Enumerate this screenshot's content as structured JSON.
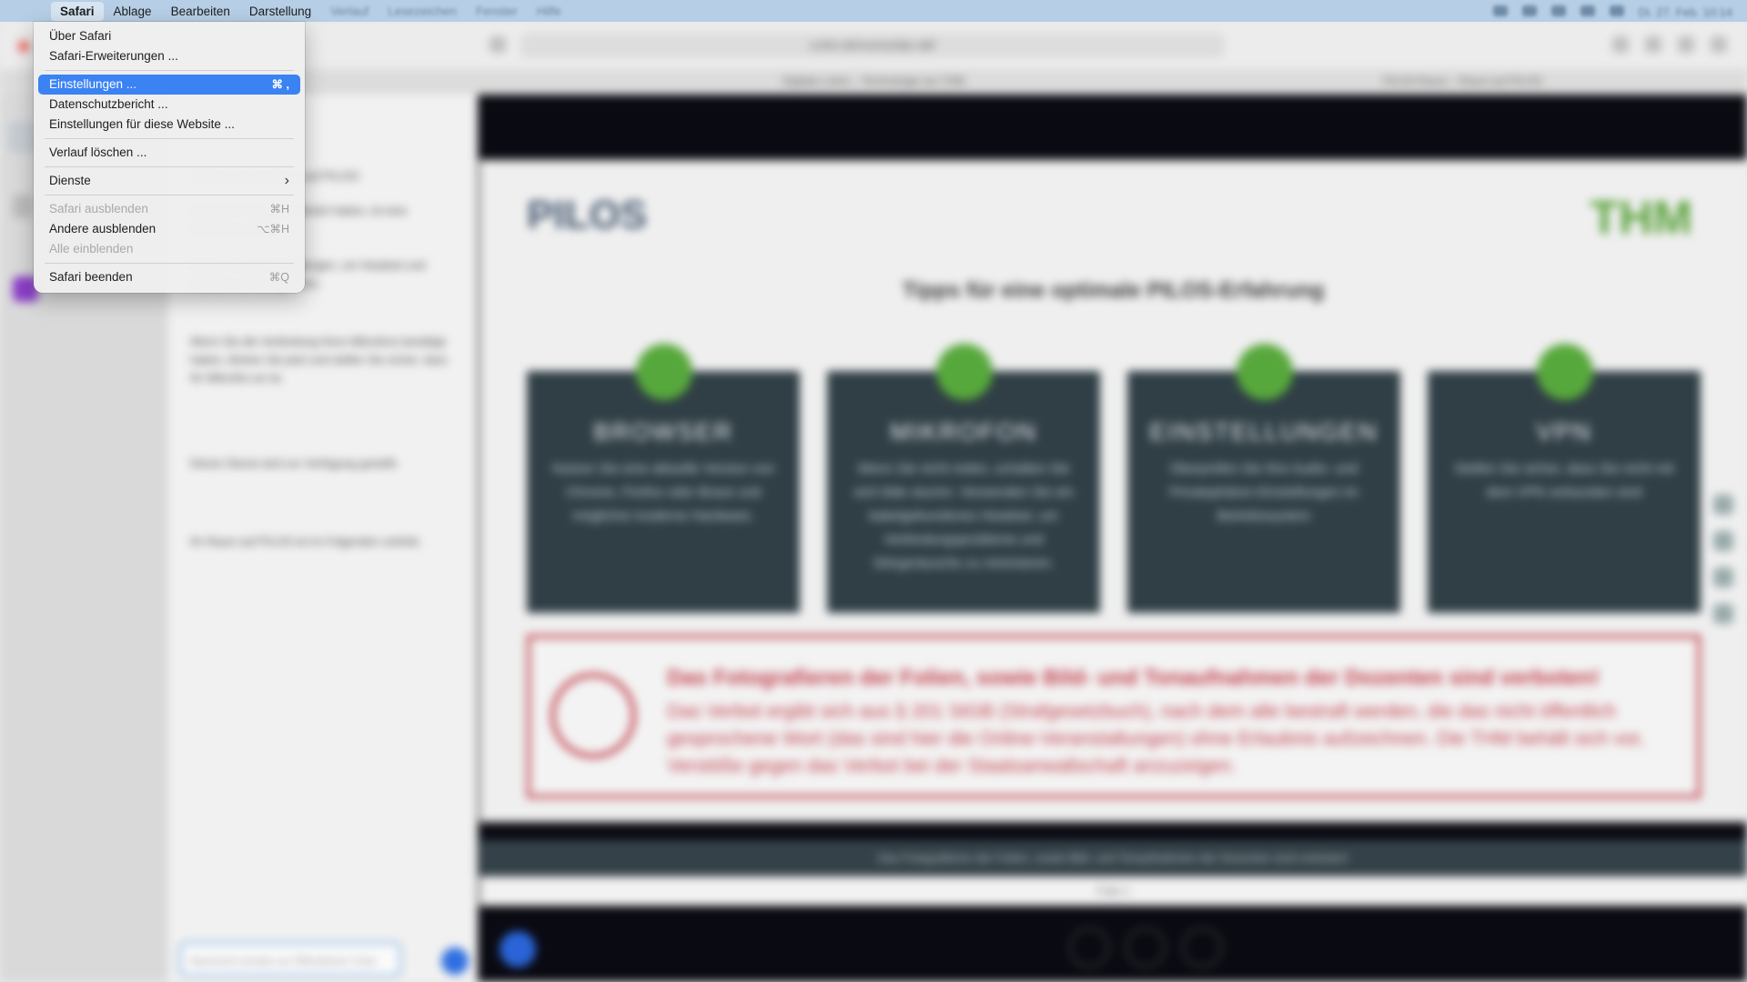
{
  "menubar": {
    "apple_icon": "apple-icon",
    "items": [
      {
        "label": "Safari"
      },
      {
        "label": "Ablage"
      },
      {
        "label": "Bearbeiten"
      },
      {
        "label": "Darstellung"
      },
      {
        "label": "Verlauf"
      },
      {
        "label": "Lesezeichen"
      },
      {
        "label": "Fenster"
      },
      {
        "label": "Hilfe"
      }
    ],
    "status_icons": [
      "battery-icon",
      "control-center-icon",
      "wifi-icon",
      "search-icon",
      "lock-icon"
    ],
    "clock": "Di. 27. Feb. 10:14"
  },
  "safari_menu": {
    "about": "Über Safari",
    "extensions": "Safari-Erweiterungen ...",
    "settings": "Einstellungen ...",
    "settings_shortcut": "⌘ ,",
    "privacy_report": "Datenschutzbericht ...",
    "website_settings": "Einstellungen für diese Website ...",
    "clear_history": "Verlauf löschen ...",
    "services": "Dienste",
    "hide_safari": "Safari ausblenden",
    "hide_safari_shortcut": "⌘H",
    "hide_others": "Andere ausblenden",
    "hide_others_shortcut": "⌥⌘H",
    "show_all": "Alle einblenden",
    "quit": "Safari beenden",
    "quit_shortcut": "⌘Q"
  },
  "browser": {
    "address": "a.thm.de/rooms/abc-def",
    "tabs": [
      "Digitale Lehre – Technologie am THM",
      "PILOS Raum – Raum auf PILOS"
    ],
    "chat_messages": [
      "Willkommen im Raum auf PILOS!",
      "Damit Sie Ihr Audio aktiviert haben, ist eine Verbindung nötig.",
      "Nutzen Sie die Einstellungen, um Headset und Mikrofon zu konfigurieren.",
      "Wenn Sie die Verbindung Ihres Mikrofons bestätigt haben, klicken Sie jetzt und stellen Sie sicher, dass Ihr Mikrofon an ist.",
      "Dieser Dienst wird zur Verfügung gestellt.",
      "Ihr Raum auf PILOS ist im Folgenden verlinkt."
    ],
    "chat_placeholder": "Nachricht senden an Öffentlicher Chat"
  },
  "slide": {
    "logo_left": "PILOS",
    "logo_right": "THM",
    "headline": "Tipps für eine optimale PILOS-Erfahrung",
    "cards": [
      {
        "title": "BROWSER",
        "text": "Nutzen Sie eine aktuelle Version von Chrome, Firefox oder Brave und möglichst moderne Hardware."
      },
      {
        "title": "MIKROFON",
        "text": "Wenn Sie nicht reden, schalten Sie sich bitte stumm. Verwenden Sie ein kabelgebundenes Headset, um Verbindungsprobleme und Störgeräusche zu minimieren."
      },
      {
        "title": "EINSTELLUNGEN",
        "text": "Überprüfen Sie Ihre Audio- und Privatsphären-Einstellungen im Betriebssystem"
      },
      {
        "title": "VPN",
        "text": "Stellen Sie sicher, dass Sie nicht mit dem VPN verbunden sind"
      }
    ],
    "warning_title": "Das Fotografieren der Folien, sowie Bild- und Tonaufnahmen der Dozenten sind verboten!",
    "warning_text": "Das Verbot ergibt sich aus § 201 StGB (Strafgesetzbuch), nach dem alle bestraft werden, die das nicht öffentlich gesprochene Wort (das sind hier die Online-Veranstaltungen) ohne Erlaubnis aufzeichnen. Die THM behält sich vor, Verstöße gegen das Verbot bei der Staatsanwaltschaft anzuzeigen.",
    "ticker": "Das Fotografieren der Folien, sowie Bild- und Tonaufnahmen der Dozenten sind verboten!",
    "pager": "Folie 1"
  },
  "colors": {
    "highlight": "#3b82f3",
    "menubar": "#b7cfe6",
    "card_bg": "#303f46",
    "green": "#57a83c",
    "warning_red": "#c0414d"
  }
}
